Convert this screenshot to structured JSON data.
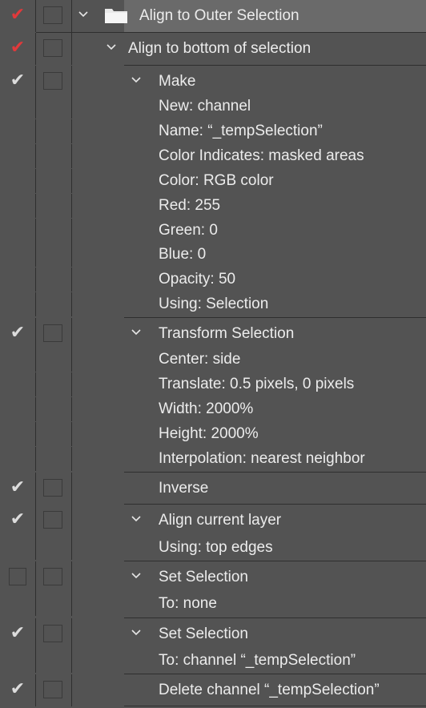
{
  "rows": [
    {
      "label": "Align to Outer Selection"
    },
    {
      "label": "Align to bottom of selection"
    },
    {
      "label": "Make"
    },
    {
      "label": "New: channel"
    },
    {
      "label": "Name:  “_tempSelection”"
    },
    {
      "label": "Color Indicates: masked areas"
    },
    {
      "label": "Color: RGB color"
    },
    {
      "label": "Red: 255"
    },
    {
      "label": "Green: 0"
    },
    {
      "label": "Blue: 0"
    },
    {
      "label": "Opacity: 50"
    },
    {
      "label": "Using: Selection"
    },
    {
      "label": "Transform Selection"
    },
    {
      "label": "Center: side"
    },
    {
      "label": "Translate: 0.5 pixels, 0 pixels"
    },
    {
      "label": "Width: 2000%"
    },
    {
      "label": "Height: 2000%"
    },
    {
      "label": "Interpolation: nearest neighbor"
    },
    {
      "label": "Inverse"
    },
    {
      "label": "Align current layer"
    },
    {
      "label": "Using: top edges"
    },
    {
      "label": "Set Selection"
    },
    {
      "label": "To: none"
    },
    {
      "label": "Set Selection"
    },
    {
      "label": "To: channel “_tempSelection”"
    },
    {
      "label": "Delete channel “_tempSelection”"
    }
  ],
  "icons": {
    "check_red": "✔",
    "check_white": "✔",
    "folder": "folder-icon",
    "chevron": "chevron-down-icon"
  },
  "colors": {
    "background": "#535353",
    "selected_row": "#6a6a6a",
    "check_red": "#e0393b",
    "check_white": "#dcdcdc"
  }
}
